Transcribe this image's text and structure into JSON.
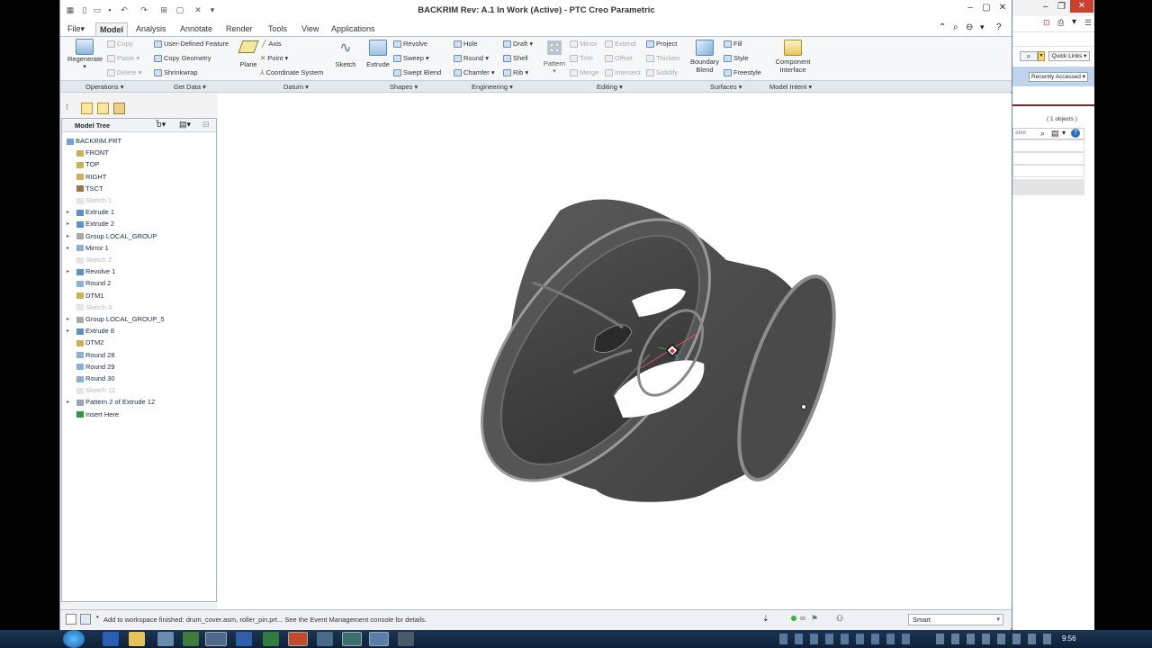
{
  "window": {
    "title": "BACKRIM Rev: A.1 In Work  (Active) - PTC Creo Parametric"
  },
  "menu_tabs": [
    {
      "label": "File",
      "dropdown": true
    },
    {
      "label": "Model"
    },
    {
      "label": "Analysis"
    },
    {
      "label": "Annotate"
    },
    {
      "label": "Render"
    },
    {
      "label": "Tools"
    },
    {
      "label": "View"
    },
    {
      "label": "Applications"
    }
  ],
  "ribbon": {
    "regenerate": "Regenerate",
    "copy": "Copy",
    "paste": "Paste",
    "delete": "Delete",
    "user_defined_feature": "User-Defined Feature",
    "copy_geometry": "Copy Geometry",
    "shrinkwrap": "Shrinkwrap",
    "plane": "Plane",
    "axis": "Axis",
    "point": "Point",
    "coordinate_system": "Coordinate System",
    "sketch": "Sketch",
    "extrude": "Extrude",
    "revolve": "Revolve",
    "sweep": "Sweep",
    "swept_blend": "Swept Blend",
    "hole": "Hole",
    "round": "Round",
    "chamfer": "Chamfer",
    "draft": "Draft",
    "shell": "Shell",
    "rib": "Rib",
    "pattern": "Pattern",
    "mirror": "Mirror",
    "trim": "Trim",
    "merge": "Merge",
    "extend": "Extend",
    "offset": "Offset",
    "intersect": "Intersect",
    "project": "Project",
    "thicken": "Thicken",
    "solidify": "Solidify",
    "boundary_blend": "Boundary\nBlend",
    "fill": "Fill",
    "style": "Style",
    "freestyle": "Freestyle",
    "component_interface": "Component\nInterface"
  },
  "groups": [
    "Operations",
    "Get Data",
    "Datum",
    "Shapes",
    "Engineering",
    "Editing",
    "Surfaces",
    "Model Intent"
  ],
  "model_tree": {
    "header": "Model Tree",
    "items": [
      {
        "label": "BACKRIM.PRT",
        "icon": "part-icon",
        "expand": false,
        "dim": false
      },
      {
        "label": "FRONT",
        "icon": "datum-plane-icon",
        "expand": false,
        "dim": false
      },
      {
        "label": "TOP",
        "icon": "datum-plane-icon",
        "expand": false,
        "dim": false
      },
      {
        "label": "RIGHT",
        "icon": "datum-plane-icon",
        "expand": false,
        "dim": false
      },
      {
        "label": "TSCT",
        "icon": "coordinate-system-icon",
        "expand": false,
        "dim": false
      },
      {
        "label": "Sketch 1",
        "icon": "sketch-icon",
        "expand": false,
        "dim": true
      },
      {
        "label": "Extrude 1",
        "icon": "extrude-icon",
        "expand": true,
        "dim": false
      },
      {
        "label": "Extrude 2",
        "icon": "extrude-icon",
        "expand": true,
        "dim": false
      },
      {
        "label": "Group LOCAL_GROUP",
        "icon": "group-icon",
        "expand": true,
        "dim": false
      },
      {
        "label": "Mirror 1",
        "icon": "mirror-icon",
        "expand": true,
        "dim": false
      },
      {
        "label": "Sketch 2",
        "icon": "sketch-icon",
        "expand": false,
        "dim": true
      },
      {
        "label": "Revolve 1",
        "icon": "revolve-icon",
        "expand": true,
        "dim": false
      },
      {
        "label": "Round 2",
        "icon": "round-icon",
        "expand": false,
        "dim": false
      },
      {
        "label": "DTM1",
        "icon": "datum-plane-icon",
        "expand": false,
        "dim": false
      },
      {
        "label": "Sketch 3",
        "icon": "sketch-icon",
        "expand": false,
        "dim": true
      },
      {
        "label": "Group LOCAL_GROUP_5",
        "icon": "group-icon",
        "expand": true,
        "dim": false
      },
      {
        "label": "Extrude 8",
        "icon": "extrude-icon",
        "expand": true,
        "dim": false
      },
      {
        "label": "DTM2",
        "icon": "datum-plane-icon",
        "expand": false,
        "dim": false
      },
      {
        "label": "Round 28",
        "icon": "round-icon",
        "expand": false,
        "dim": false
      },
      {
        "label": "Round 29",
        "icon": "round-icon",
        "expand": false,
        "dim": false
      },
      {
        "label": "Round 30",
        "icon": "round-icon",
        "expand": false,
        "dim": false
      },
      {
        "label": "Sketch 12",
        "icon": "sketch-icon",
        "expand": false,
        "dim": true
      },
      {
        "label": "Pattern 2 of Extrude 12",
        "icon": "pattern-icon",
        "expand": true,
        "dim": false
      },
      {
        "label": "Insert Here",
        "icon": "insert-arrow-icon",
        "expand": false,
        "dim": false
      }
    ]
  },
  "status": {
    "message": "Add to workspace finished: drum_cover.asm, roller_pin.prt...  See the Event Management console for details.",
    "filter": "Smart"
  },
  "browser_panel": {
    "quick_links": "Quick Links",
    "recently_accessed": "Recently Accessed",
    "objects_count": "( 1 objects )",
    "search_placeholder": "able"
  },
  "taskbar": {
    "clock": "9:56"
  }
}
